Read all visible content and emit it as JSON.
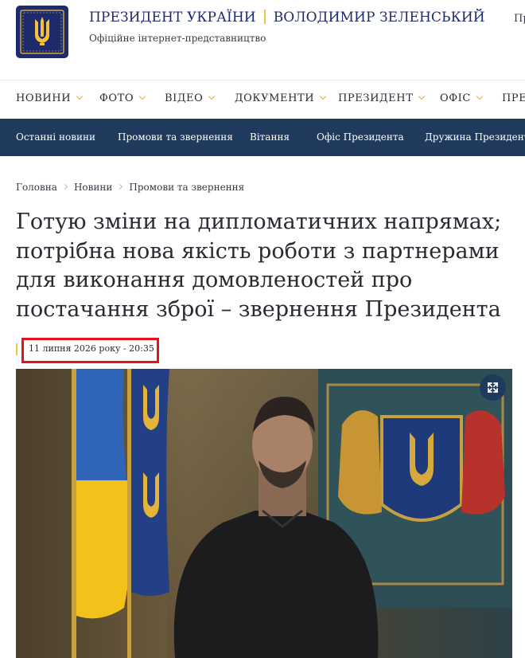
{
  "header": {
    "title_left": "ПРЕЗИДЕНТ УКРАЇНИ",
    "title_right": "ВОЛОДИМИР ЗЕЛЕНСЬКИЙ",
    "subtitle": "Офіційне інтернет-представництво",
    "lang": "Пр",
    "logo_icon": "trident-coat-of-arms-icon"
  },
  "main_nav": {
    "items": [
      {
        "label": "НОВИНИ"
      },
      {
        "label": "ФОТО"
      },
      {
        "label": "ВІДЕО"
      },
      {
        "label": "ДОКУМЕНТИ"
      },
      {
        "label": "ПРЕЗИДЕНТ"
      },
      {
        "label": "ОФІС"
      },
      {
        "label": "ПРЕС"
      }
    ],
    "chevron_icon": "chevron-down-icon"
  },
  "sub_nav": {
    "items": [
      {
        "label": "Останні новини"
      },
      {
        "label": "Промови та звернення"
      },
      {
        "label": "Вітання"
      },
      {
        "label": "Офіс Президента"
      },
      {
        "label": "Дружина Президента"
      }
    ]
  },
  "breadcrumb": {
    "items": [
      "Головна",
      "Новини",
      "Промови та звернення"
    ]
  },
  "article": {
    "title": "Готую зміни на дипломатичних напрямах; потрібна нова якість роботи з партнерами для виконання домовленостей про постачання зброї – звернення Президента",
    "date": "11 липня 2026 року - 20:35"
  },
  "photo": {
    "expand_icon": "expand-fullscreen-icon"
  },
  "colors": {
    "navy": "#1d2a6b",
    "subnav_bg": "#1f3a5c",
    "gold": "#f5c13d",
    "highlight": "#e0141a"
  }
}
